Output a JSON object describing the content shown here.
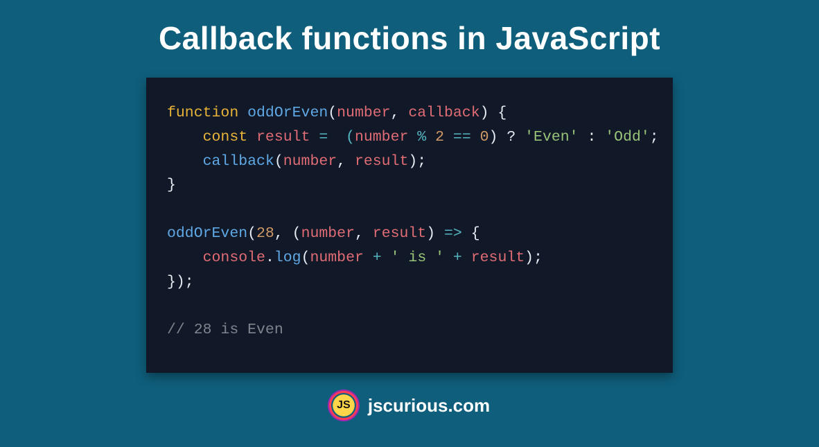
{
  "title": "Callback functions in JavaScript",
  "footer": {
    "logo_text": "JS",
    "site": "jscurious.com"
  },
  "code": {
    "l1": {
      "kw": "function",
      "fn": "oddOrEven",
      "p1": "number",
      "c1": ", ",
      "p2": "callback",
      "rp": ") {"
    },
    "l2": {
      "indent": "    ",
      "kw": "const",
      "id": "result",
      "eq": " =  (",
      "p1": "number",
      "mod": " % ",
      "two": "2",
      "cmp": " == ",
      "zero": "0",
      "q": ") ? ",
      "s1": "'Even'",
      "col": " : ",
      "s2": "'Odd'",
      "semi": ";"
    },
    "l3": {
      "indent": "    ",
      "fn": "callback",
      "lp": "(",
      "p1": "number",
      "c1": ", ",
      "p2": "result",
      "rp": ");"
    },
    "l4": {
      "t": "}"
    },
    "l5": {
      "t": ""
    },
    "l6": {
      "fn": "oddOrEven",
      "lp": "(",
      "n": "28",
      "c1": ", (",
      "p1": "number",
      "c2": ", ",
      "p2": "result",
      "rp": ") ",
      "arrow": "=>",
      "ob": " {"
    },
    "l7": {
      "indent": "    ",
      "obj": "console",
      "dot": ".",
      "fn": "log",
      "lp": "(",
      "p1": "number",
      "plus1": " + ",
      "s1": "' is '",
      "plus2": " + ",
      "p2": "result",
      "rp": ");"
    },
    "l8": {
      "t": "});"
    },
    "l9": {
      "t": ""
    },
    "l10": {
      "cmt": "// 28 is Even"
    }
  }
}
